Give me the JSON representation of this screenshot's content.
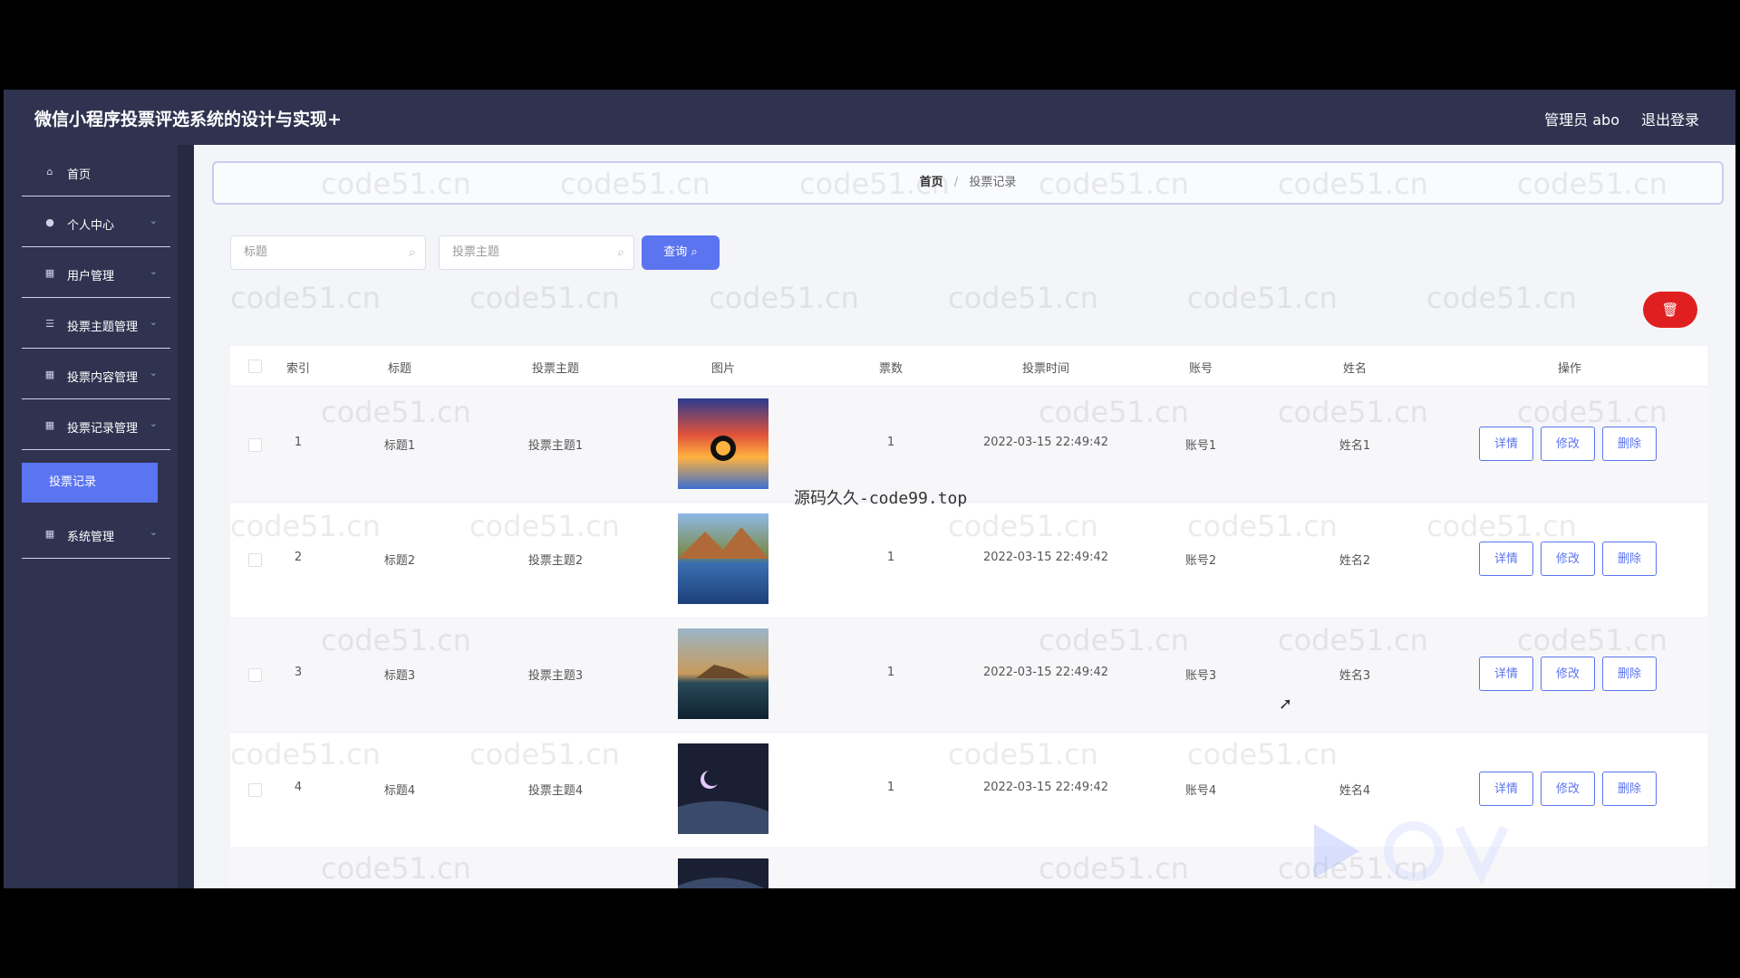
{
  "app": {
    "title": "微信小程序投票评选系统的设计与实现+",
    "admin_label": "管理员 abo",
    "logout_label": "退出登录"
  },
  "sidebar": {
    "items": [
      {
        "label": "首页",
        "icon": "home-icon"
      },
      {
        "label": "个人中心",
        "icon": "user-icon"
      },
      {
        "label": "用户管理",
        "icon": "grid-icon"
      },
      {
        "label": "投票主题管理",
        "icon": "list-icon"
      },
      {
        "label": "投票内容管理",
        "icon": "grid-icon"
      },
      {
        "label": "投票记录管理",
        "icon": "grid-icon"
      },
      {
        "label": "系统管理",
        "icon": "grid-icon"
      }
    ],
    "active_sub": "投票记录"
  },
  "breadcrumb": {
    "home": "首页",
    "separator": "/",
    "current": "投票记录"
  },
  "search": {
    "title_placeholder": "标题",
    "theme_placeholder": "投票主题",
    "query_label": "查询"
  },
  "table": {
    "headers": [
      "索引",
      "标题",
      "投票主题",
      "图片",
      "票数",
      "投票时间",
      "账号",
      "姓名",
      "操作"
    ],
    "rows": [
      {
        "index": "1",
        "title": "标题1",
        "theme": "投票主题1",
        "votes": "1",
        "time": "2022-03-15 22:49:42",
        "account": "账号1",
        "name": "姓名1"
      },
      {
        "index": "2",
        "title": "标题2",
        "theme": "投票主题2",
        "votes": "1",
        "time": "2022-03-15 22:49:42",
        "account": "账号2",
        "name": "姓名2"
      },
      {
        "index": "3",
        "title": "标题3",
        "theme": "投票主题3",
        "votes": "1",
        "time": "2022-03-15 22:49:42",
        "account": "账号3",
        "name": "姓名3"
      },
      {
        "index": "4",
        "title": "标题4",
        "theme": "投票主题4",
        "votes": "1",
        "time": "2022-03-15 22:49:42",
        "account": "账号4",
        "name": "姓名4"
      }
    ],
    "ops": {
      "detail": "详情",
      "edit": "修改",
      "delete": "删除"
    }
  },
  "watermark": "code51.cn",
  "overlay_text": "源码久久-code99.top",
  "colors": {
    "header_bg": "#2f3350",
    "accent": "#5b74f0",
    "danger": "#e02020"
  }
}
